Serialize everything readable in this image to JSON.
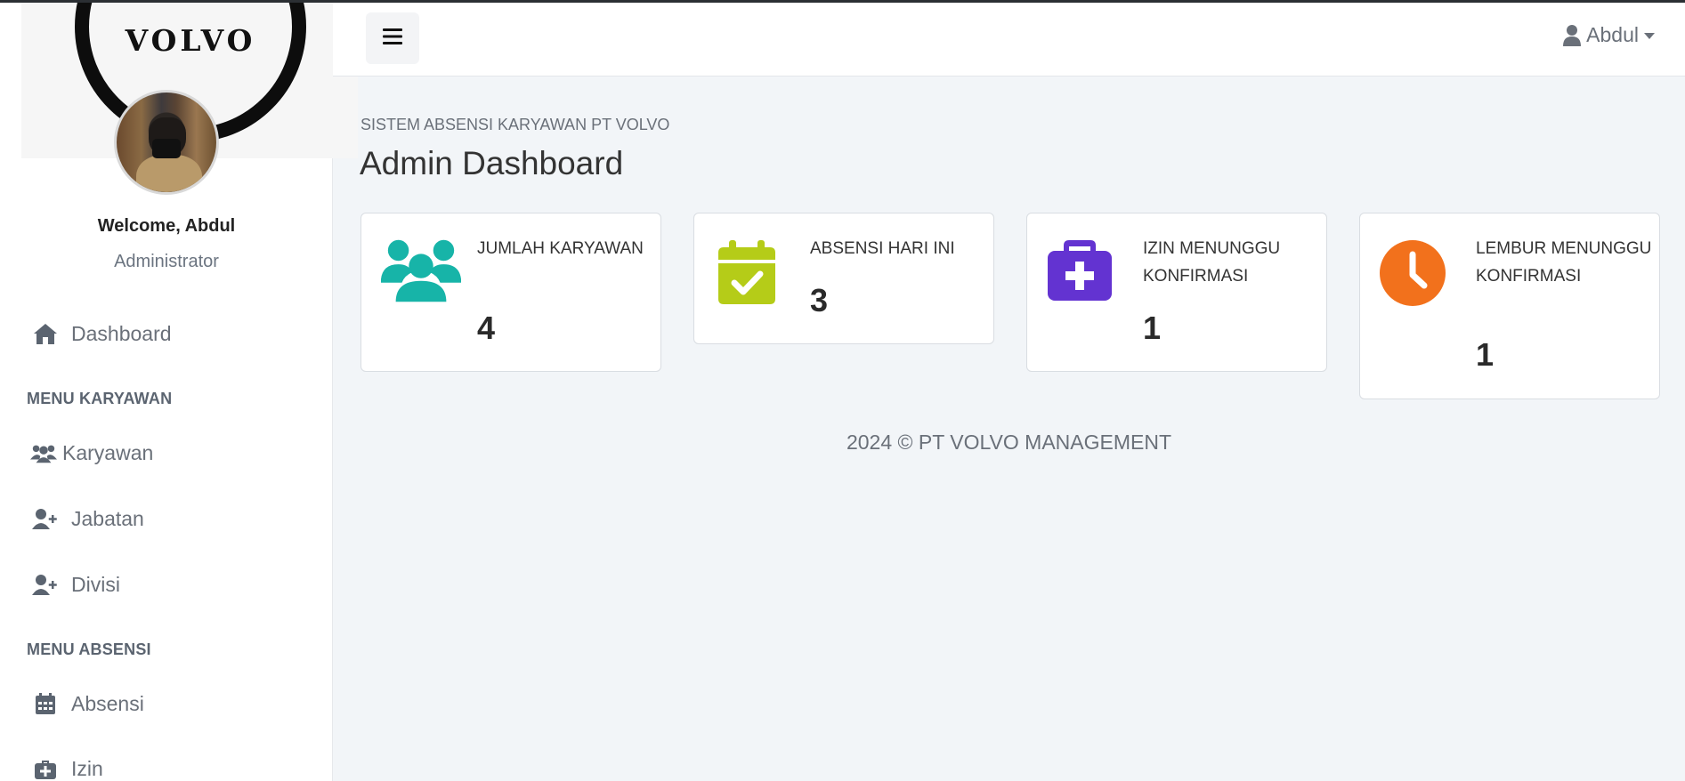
{
  "sidebar": {
    "logo_text": "VOLVO",
    "welcome": "Welcome, Abdul",
    "role": "Administrator",
    "dashboard_label": "Dashboard",
    "section_karyawan": "MENU KARYAWAN",
    "karyawan_label": "Karyawan",
    "jabatan_label": "Jabatan",
    "divisi_label": "Divisi",
    "section_absensi": "MENU ABSENSI",
    "absensi_label": "Absensi",
    "izin_label": "Izin"
  },
  "topbar": {
    "user_name": "Abdul"
  },
  "main": {
    "kicker": "SISTEM ABSENSI KARYAWAN PT VOLVO",
    "title": "Admin Dashboard",
    "cards": [
      {
        "label": "JUMLAH KARYAWAN",
        "value": "4",
        "icon": "users-icon",
        "color": "#17b4a8"
      },
      {
        "label": "ABSENSI HARI INI",
        "value": "3",
        "icon": "calendar-check-icon",
        "color": "#b5cc18"
      },
      {
        "label": "IZIN MENUNGGU KONFIRMASI",
        "value": "1",
        "icon": "medkit-icon",
        "color": "#6333d1"
      },
      {
        "label": "LEMBUR MENUNGGU KONFIRMASI",
        "value": "1",
        "icon": "clock-icon",
        "color": "#f2711c"
      }
    ]
  },
  "footer": {
    "text": "2024 © PT VOLVO MANAGEMENT"
  }
}
